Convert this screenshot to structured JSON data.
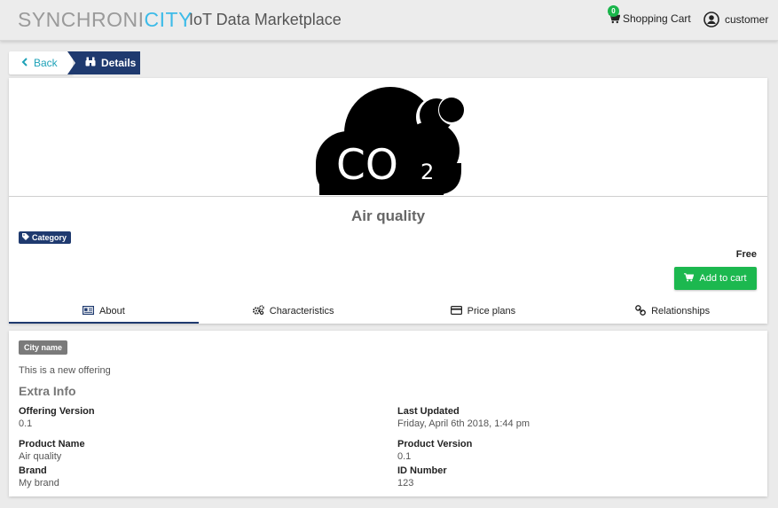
{
  "header": {
    "logo_part1": "SYNCHRONI",
    "logo_part2": "CITY",
    "app_title": "IoT Data Marketplace",
    "cart_count": "0",
    "cart_label": "Shopping Cart",
    "user_label": "customer"
  },
  "breadcrumb": {
    "back_label": "Back",
    "details_label": "Details"
  },
  "product": {
    "image_text_main": "CO",
    "image_text_sub": "2",
    "title": "Air quality",
    "category_label": "Category",
    "price": "Free",
    "add_to_cart_label": "Add to cart"
  },
  "tabs": [
    {
      "label": "About",
      "icon": "id-card-icon"
    },
    {
      "label": "Characteristics",
      "icon": "gears-icon"
    },
    {
      "label": "Price plans",
      "icon": "credit-card-icon"
    },
    {
      "label": "Relationships",
      "icon": "link-icon"
    }
  ],
  "about": {
    "city_badge": "City name",
    "description": "This is a new offering",
    "extra_title": "Extra Info",
    "fields": [
      {
        "label": "Offering Version",
        "value": "0.1"
      },
      {
        "label": "Last Updated",
        "value": "Friday, April 6th 2018, 1:44 pm"
      },
      {
        "label": "Product Name",
        "value": "Air quality"
      },
      {
        "label": "Product Version",
        "value": "0.1"
      },
      {
        "label": "Brand",
        "value": "My brand"
      },
      {
        "label": "ID Number",
        "value": "123"
      }
    ]
  },
  "colors": {
    "navy": "#1f3a6f",
    "green": "#1cb84f",
    "teal": "#1fa2b8",
    "logo_blue": "#3dbbe8"
  }
}
